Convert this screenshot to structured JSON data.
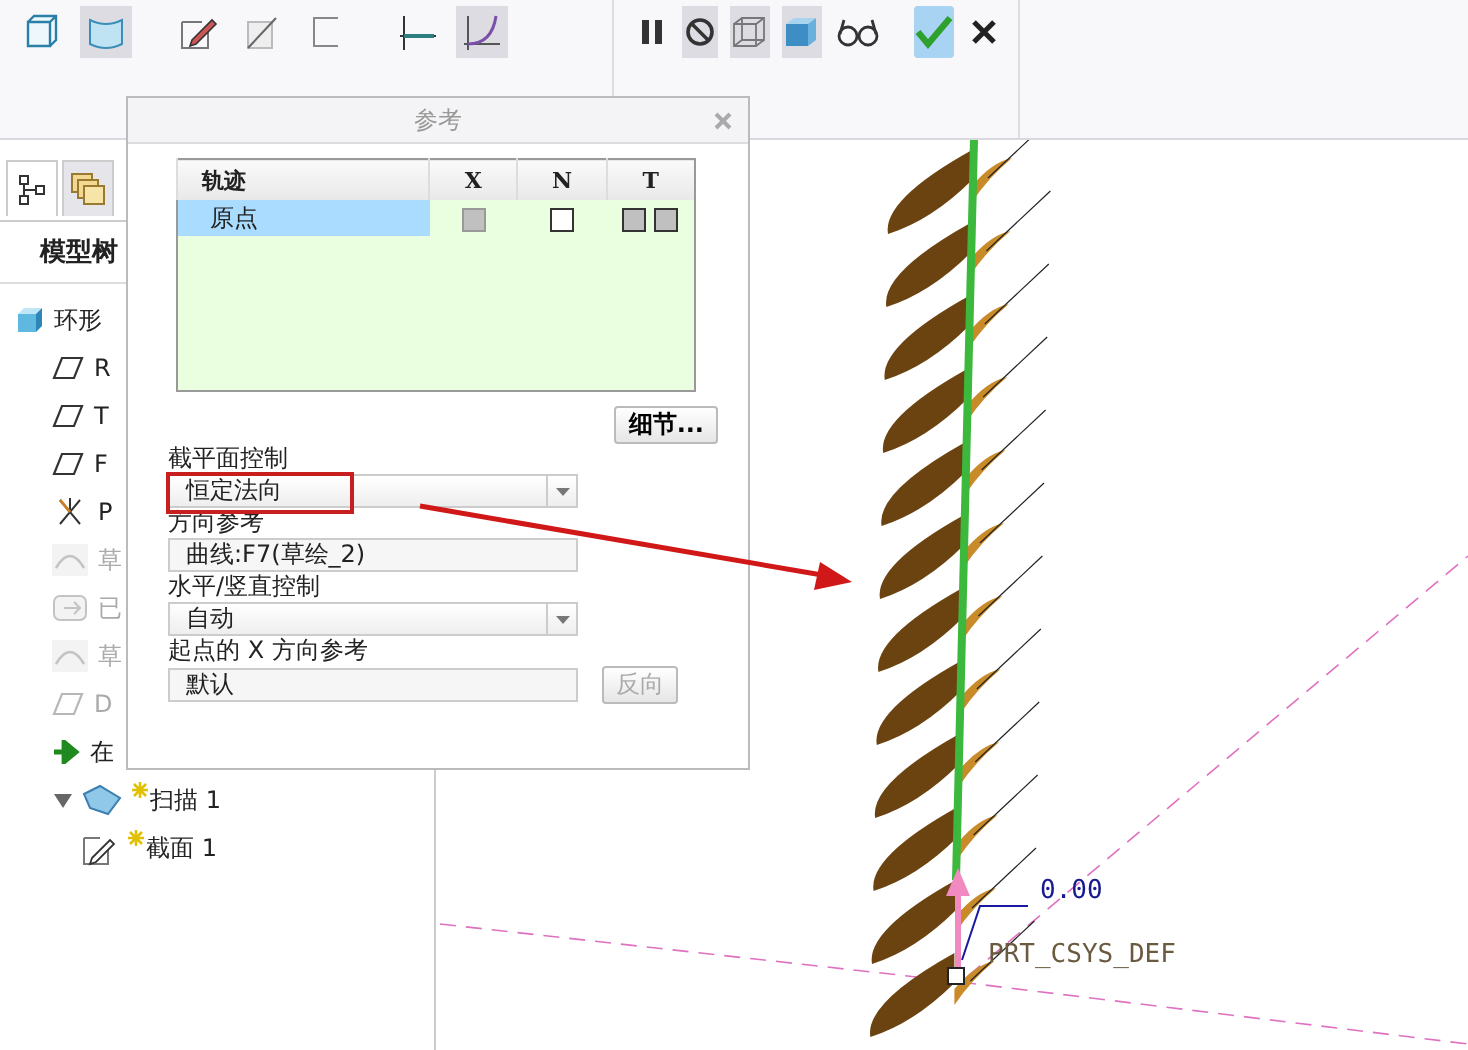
{
  "ribbon": {
    "left_tools": [
      {
        "kind": "cube",
        "selected": false
      },
      {
        "kind": "surface",
        "selected": true
      },
      {
        "kind": "pencil",
        "selected": false
      },
      {
        "kind": "slash",
        "selected": false
      },
      {
        "kind": "bracket",
        "selected": false
      },
      {
        "kind": "axis",
        "selected": false
      },
      {
        "kind": "curve",
        "selected": true
      }
    ],
    "right_tools": [
      {
        "kind": "pause",
        "selected": false
      },
      {
        "kind": "no-entry",
        "selected": true
      },
      {
        "kind": "wire-cube",
        "selected": true
      },
      {
        "kind": "shaded-cube",
        "selected": true
      },
      {
        "kind": "glasses",
        "selected": false
      },
      {
        "kind": "check",
        "selected": true
      },
      {
        "kind": "close",
        "selected": false
      }
    ]
  },
  "model_tree": {
    "tabs": [
      {
        "kind": "tree",
        "selected": true
      },
      {
        "kind": "layers",
        "selected": false
      }
    ],
    "title": "模型树",
    "items": [
      {
        "label": "环形",
        "kind": "part",
        "disabled": false,
        "children": [
          {
            "label": "R",
            "kind": "plane",
            "disabled": false
          },
          {
            "label": "T",
            "kind": "plane",
            "disabled": false
          },
          {
            "label": "F",
            "kind": "plane",
            "disabled": false
          },
          {
            "label": "P",
            "kind": "csys",
            "disabled": false
          },
          {
            "label": "草",
            "kind": "sketch",
            "disabled": true
          },
          {
            "label": "已",
            "kind": "feature",
            "disabled": true
          },
          {
            "label": "草",
            "kind": "sketch",
            "disabled": true
          },
          {
            "label": "D",
            "kind": "plane",
            "disabled": true
          },
          {
            "label": "在",
            "kind": "insert",
            "disabled": false
          },
          {
            "label": "扫描 1",
            "kind": "sweep",
            "disabled": false,
            "new": true,
            "expanded": true,
            "children": [
              {
                "label": "截面 1",
                "kind": "section",
                "disabled": false,
                "new": true
              }
            ]
          }
        ]
      }
    ]
  },
  "dialog": {
    "title": "参考",
    "table": {
      "columns": [
        "轨迹",
        "X",
        "N",
        "T"
      ],
      "rows": [
        {
          "name": "原点",
          "selected": true,
          "x": {
            "checked": false,
            "disabled": true
          },
          "n": {
            "checked": false,
            "disabled": false
          },
          "t": [
            {
              "checked": false,
              "disabled": true
            },
            {
              "checked": false,
              "disabled": true
            }
          ]
        }
      ]
    },
    "details_button": "细节...",
    "section_control": {
      "label": "截平面控制",
      "value": "恒定法向"
    },
    "direction_reference": {
      "label": "方向参考",
      "value": "曲线:F7(草绘_2)"
    },
    "horizontal_vertical_control": {
      "label": "水平/竖直控制",
      "value": "自动"
    },
    "start_x_reference": {
      "label": "起点的 X 方向参考",
      "value": "默认",
      "button": "反向",
      "button_disabled": true
    }
  },
  "graphics": {
    "dimension": "0.00",
    "csys_label": "PRT_CSYS_DEF"
  }
}
